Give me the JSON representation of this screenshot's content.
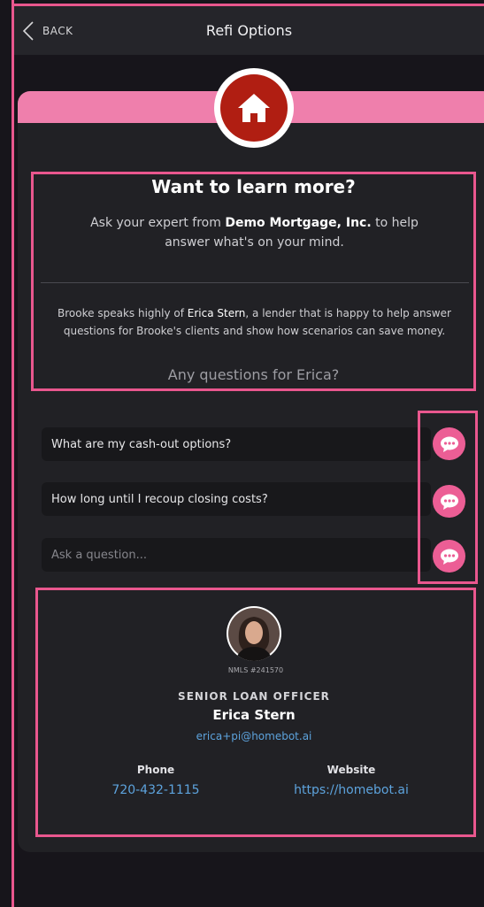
{
  "nav": {
    "back_label": "BACK",
    "title": "Refi Options"
  },
  "header": {
    "headline": "Want to learn more?",
    "lead_prefix": "Ask your expert from ",
    "company": "Demo Mortgage, Inc.",
    "lead_suffix": " to help answer what's on your mind."
  },
  "intro": {
    "agent": "Brooke",
    "blurb_part1": " speaks highly of ",
    "lender": "Erica Stern",
    "blurb_part2": ", a lender that is happy to help answer questions for Brooke's clients and show how scenarios can save money.",
    "prompt": "Any questions for Erica?"
  },
  "questions": [
    {
      "label": "What are my cash-out options?"
    },
    {
      "label": "How long until I recoup closing costs?"
    }
  ],
  "ask": {
    "placeholder": "Ask a question..."
  },
  "contact": {
    "nmls": "NMLS #241570",
    "role": "SENIOR LOAN OFFICER",
    "name": "Erica Stern",
    "email": "erica+pi@homebot.ai",
    "phone_label": "Phone",
    "phone": "720-432-1115",
    "website_label": "Website",
    "website": "https://homebot.ai"
  },
  "colors": {
    "accent_pink": "#e9578e",
    "chat_bubble": "#ec5e95",
    "house_red": "#b01e12",
    "link_blue": "#5da3dd"
  },
  "icons": {
    "back": "chevron-left-icon",
    "house": "house-icon",
    "chat": "chat-bubble-icon"
  }
}
